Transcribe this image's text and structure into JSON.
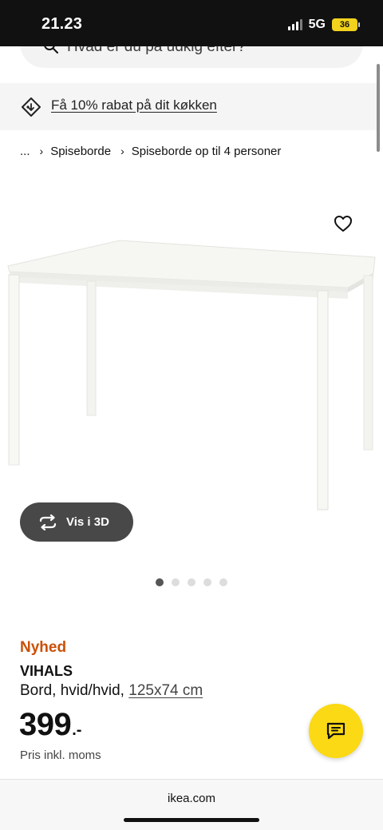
{
  "status_bar": {
    "time": "21.23",
    "network": "5G",
    "battery": "36"
  },
  "search": {
    "placeholder": "Hvad er du på udkig efter?"
  },
  "promo": {
    "text": "Få 10% rabat på dit køkken"
  },
  "breadcrumb": {
    "items": [
      "...",
      "Spiseborde",
      "Spiseborde op til 4 personer"
    ]
  },
  "gallery": {
    "view_3d_label": "Vis i 3D",
    "image_count": 5,
    "active_image": 1
  },
  "product": {
    "badge": "Nyhed",
    "name": "VIHALS",
    "description": "Bord, hvid/hvid, ",
    "dimensions": "125x74 cm",
    "price": "399",
    "price_suffix": ".-",
    "price_note": "Pris inkl. moms"
  },
  "browser": {
    "url": "ikea.com"
  },
  "colors": {
    "badge": "#ca5008",
    "chat_fab": "#fbd914",
    "view_3d_button": "#484848"
  },
  "icons": {
    "search": "search-icon",
    "promo": "price-tag-icon",
    "favorite": "heart-icon",
    "view_3d": "rotate-3d-icon",
    "chat": "chat-icon"
  }
}
